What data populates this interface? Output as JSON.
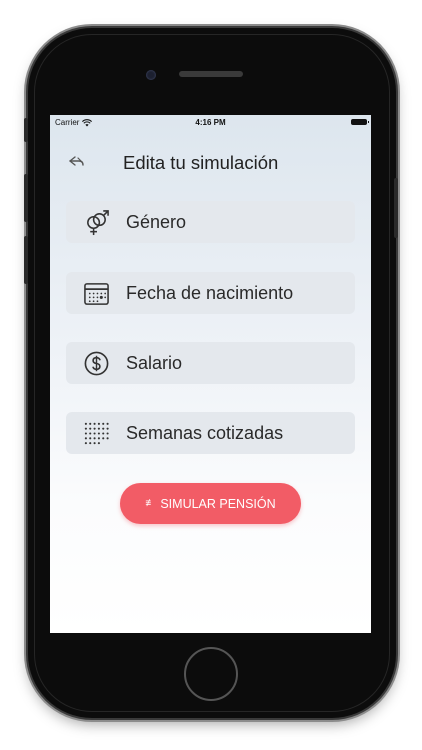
{
  "status_bar": {
    "carrier": "Carrier",
    "time": "4:16 PM"
  },
  "header": {
    "title": "Edita tu simulación"
  },
  "fields": [
    {
      "label": "Género",
      "icon": "gender-icon"
    },
    {
      "label": "Fecha de nacimiento",
      "icon": "calendar-icon"
    },
    {
      "label": "Salario",
      "icon": "dollar-circle-icon"
    },
    {
      "label": "Semanas cotizadas",
      "icon": "dot-grid-icon"
    }
  ],
  "cta": {
    "label": "SIMULAR PENSIÓN",
    "icon": "sliders-icon",
    "icon_glyph": "≢"
  },
  "colors": {
    "accent": "#f25c66",
    "field_bg": "#e4e8ed",
    "text": "#222222"
  }
}
